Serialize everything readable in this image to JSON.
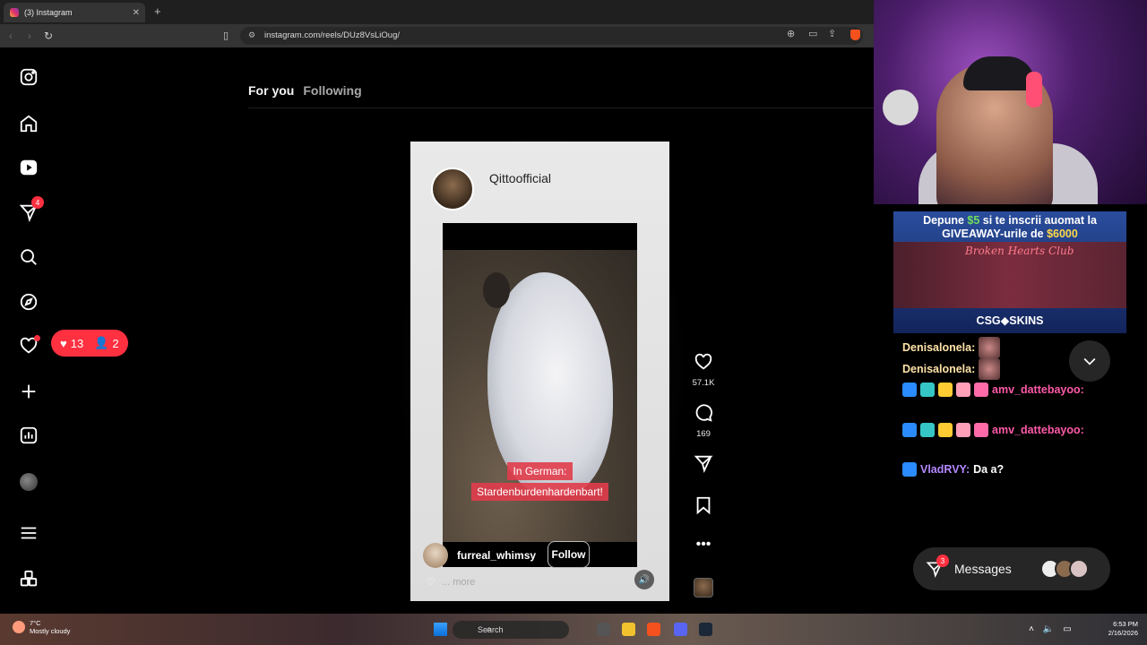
{
  "browser": {
    "tab_title": "(3) Instagram",
    "tab_close": "✕",
    "new_tab": "+",
    "url": "instagram.com/reels/DUz8VsLiOug/"
  },
  "instagram": {
    "nav_tabs": [
      {
        "label": "For you",
        "active": true
      },
      {
        "label": "Following",
        "active": false
      }
    ],
    "sidebar": {
      "messages_badge": "4",
      "notif_pill": {
        "likes": "13",
        "follows": "2"
      }
    },
    "reel": {
      "card_username": "Qittoofficial",
      "caption_lines": [
        "In German:",
        "Stardenburdenhardenbart!"
      ],
      "author": "furreal_whimsy",
      "follow_label": "Follow",
      "more_label": "... more",
      "likes": "57.1K",
      "comments": "169"
    },
    "messages": {
      "label": "Messages",
      "badge": "3"
    }
  },
  "stream": {
    "ad": {
      "line1_prefix": "Depune ",
      "line1_amount": "$5",
      "line1_suffix": " si te inscrii auomat la",
      "line2_prefix": "GIVEAWAY-urile de ",
      "line2_amount": "$6000",
      "club": "Broken Hearts Club",
      "brand": "CSG◆SKINS"
    },
    "chat": [
      {
        "user": "Denisalonela:",
        "message": ""
      },
      {
        "user": "Denisalonela:",
        "message": ""
      },
      {
        "user": "amv_dattebayoo:",
        "message": ""
      },
      {
        "user": "amv_dattebayoo:",
        "message": ""
      },
      {
        "user": "VladRVY:",
        "message": "Da a?"
      }
    ]
  },
  "taskbar": {
    "temperature": "7°C",
    "weather": "Mostly cloudy",
    "search_placeholder": "Search",
    "time": "6:53 PM",
    "date": "2/16/2026"
  },
  "colors": {
    "accent_red": "#ff3040",
    "stream_green": "#6fe05a",
    "stream_yellow": "#ffd84a"
  }
}
